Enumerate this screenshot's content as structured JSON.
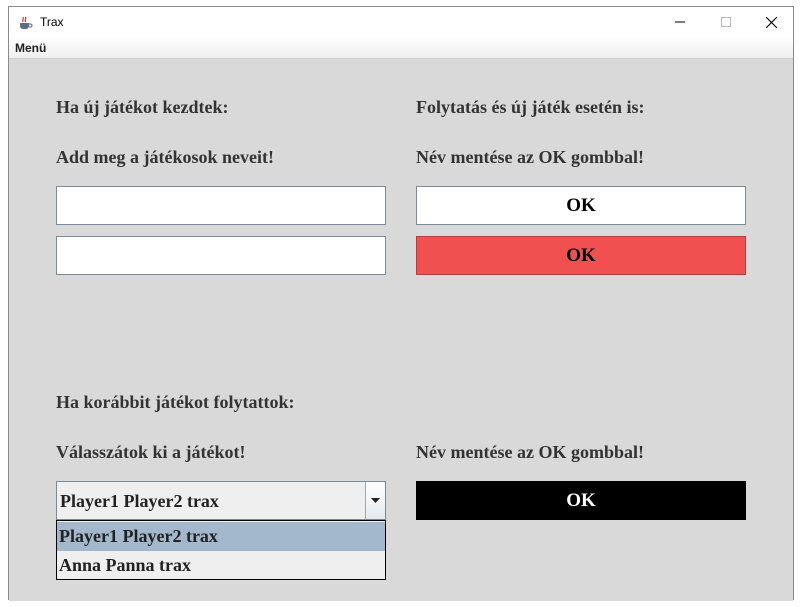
{
  "window": {
    "title": "Trax",
    "icon": "java-cup-icon"
  },
  "menu": {
    "label": "Menü"
  },
  "left": {
    "new_heading": "Ha új játékot kezdtek:",
    "new_instruction": "Add meg a játékosok neveit!",
    "player1_value": "",
    "player2_value": "",
    "continue_heading": "Ha korábbit játékot folytattok:",
    "continue_instruction": "Válasszátok ki a játékot!",
    "combo_selected": "Player1 Player2 trax",
    "combo_options": [
      "Player1 Player2 trax",
      "Anna Panna trax"
    ]
  },
  "right": {
    "heading": "Folytatás és új játék esetén is:",
    "save_instruction_top": "Név mentése az OK gombbal!",
    "ok1_label": "OK",
    "ok2_label": "OK",
    "save_instruction_bottom": "Név mentése az OK gombbal!",
    "ok3_label": "OK"
  },
  "colors": {
    "ok1_bg": "#ffffff",
    "ok2_bg": "#f05050",
    "ok3_bg": "#000000",
    "ok3_text": "#ffffff",
    "selected_option_bg": "#a3b8cc"
  }
}
